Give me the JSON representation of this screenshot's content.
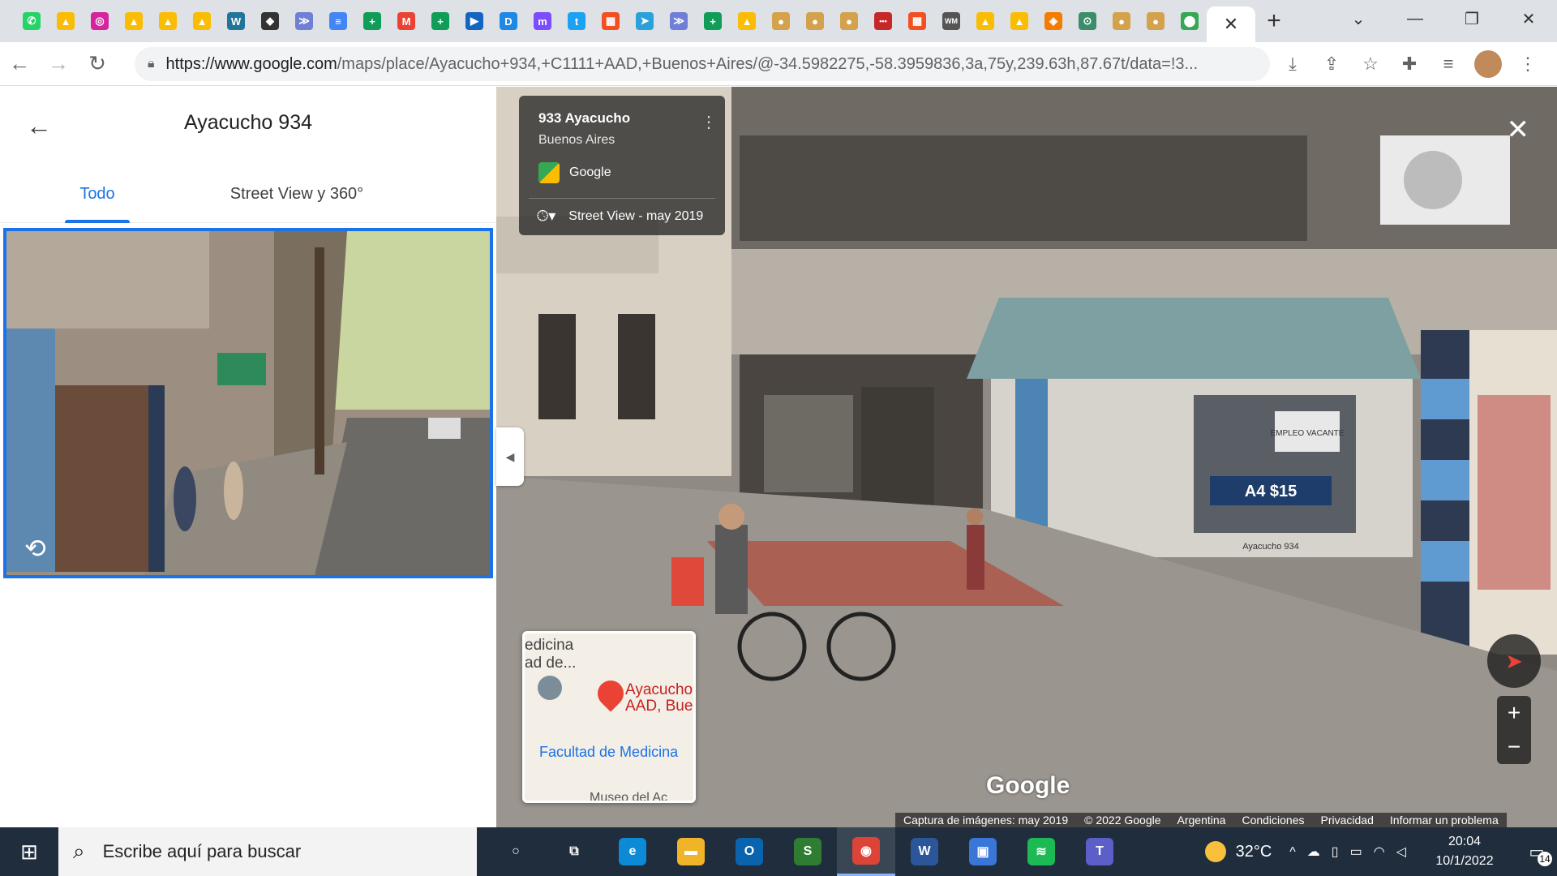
{
  "browser": {
    "favicons": [
      {
        "icon": "whatsapp-icon",
        "color": "#25d366",
        "glyph": "✆"
      },
      {
        "icon": "drive-icon",
        "color": "#fbbc04",
        "glyph": "▲"
      },
      {
        "icon": "instagram-icon",
        "color": "#d6249f",
        "glyph": "◎"
      },
      {
        "icon": "drive-icon",
        "color": "#fbbc04",
        "glyph": "▲"
      },
      {
        "icon": "drive-icon",
        "color": "#fbbc04",
        "glyph": "▲"
      },
      {
        "icon": "drive-icon",
        "color": "#fbbc04",
        "glyph": "▲"
      },
      {
        "icon": "wordpress-icon",
        "color": "#21759b",
        "glyph": "W"
      },
      {
        "icon": "shield-icon",
        "color": "#333333",
        "glyph": "◆"
      },
      {
        "icon": "stream-icon",
        "color": "#6f7fd6",
        "glyph": "≫"
      },
      {
        "icon": "docs-icon",
        "color": "#4285f4",
        "glyph": "≡"
      },
      {
        "icon": "sheets-icon",
        "color": "#0f9d58",
        "glyph": "+"
      },
      {
        "icon": "gmail-icon",
        "color": "#ea4335",
        "glyph": "M"
      },
      {
        "icon": "sheets-icon",
        "color": "#0f9d58",
        "glyph": "+"
      },
      {
        "icon": "play-icon",
        "color": "#1565c0",
        "glyph": "▶"
      },
      {
        "icon": "d-icon",
        "color": "#1e88e5",
        "glyph": "D"
      },
      {
        "icon": "m-icon",
        "color": "#7c4dff",
        "glyph": "m"
      },
      {
        "icon": "twitter-icon",
        "color": "#1da1f2",
        "glyph": "t"
      },
      {
        "icon": "windows-icon",
        "color": "#f25022",
        "glyph": "▦"
      },
      {
        "icon": "telegram-icon",
        "color": "#2aa1da",
        "glyph": "➤"
      },
      {
        "icon": "stream-icon",
        "color": "#6f7fd6",
        "glyph": "≫"
      },
      {
        "icon": "sheets-icon",
        "color": "#0f9d58",
        "glyph": "+"
      },
      {
        "icon": "drive-icon",
        "color": "#fbbc04",
        "glyph": "▲"
      },
      {
        "icon": "pie-icon",
        "color": "#d4a24c",
        "glyph": "●"
      },
      {
        "icon": "pie-icon",
        "color": "#d4a24c",
        "glyph": "●"
      },
      {
        "icon": "pie-icon",
        "color": "#d4a24c",
        "glyph": "●"
      },
      {
        "icon": "dots-icon",
        "color": "#c62828",
        "glyph": "•••"
      },
      {
        "icon": "windows-icon",
        "color": "#f25022",
        "glyph": "▦"
      },
      {
        "icon": "wm-icon",
        "color": "#555555",
        "glyph": "WM"
      },
      {
        "icon": "drive-icon",
        "color": "#fbbc04",
        "glyph": "▲"
      },
      {
        "icon": "drive-icon",
        "color": "#fbbc04",
        "glyph": "▲"
      },
      {
        "icon": "orange-icon",
        "color": "#f57c00",
        "glyph": "◈"
      },
      {
        "icon": "pin-icon",
        "color": "#3c8d6a",
        "glyph": "⊙"
      },
      {
        "icon": "pie-icon",
        "color": "#d4a24c",
        "glyph": "●"
      },
      {
        "icon": "pie-icon",
        "color": "#d4a24c",
        "glyph": "●"
      },
      {
        "icon": "maps-icon",
        "color": "#34a853",
        "glyph": "⬤"
      }
    ],
    "active_tab_close": "✕",
    "new_tab": "+",
    "url_host": "https://www.google.com",
    "url_path": "/maps/place/Ayacucho+934,+C1111+AAD,+Buenos+Aires/@-34.5982275,-58.3959836,3a,75y,239.63h,87.67t/data=!3..."
  },
  "left_panel": {
    "title": "Ayacucho 934",
    "tabs": [
      "Todo",
      "Street View y 360°"
    ]
  },
  "street_view": {
    "card_title": "933 Ayacucho",
    "card_subtitle": "Buenos Aires",
    "card_source": "Google",
    "card_history": "Street View - may 2019",
    "watermark": "Google",
    "minimap": {
      "label_top": "edicina\nad de...",
      "pin_label": "Ayacucho\nAAD, Bue",
      "facultad": "Facultad de Medicina",
      "museo": "Museo del Ac"
    },
    "attribution": [
      "Captura de imágenes: may 2019",
      "© 2022 Google",
      "Argentina",
      "Condiciones",
      "Privacidad",
      "Informar un problema"
    ],
    "scene_signs": [
      "A4 $15",
      "EMPLEO VACANTE",
      "Ayacucho 934"
    ]
  },
  "taskbar": {
    "search_placeholder": "Escribe aquí para buscar",
    "temperature": "32°C",
    "time": "20:04",
    "date": "10/1/2022",
    "notifications": "14",
    "apps": [
      {
        "icon": "cortana-icon",
        "color": "#1f2d3d",
        "glyph": "○"
      },
      {
        "icon": "taskview-icon",
        "color": "#1f2d3d",
        "glyph": "⧉"
      },
      {
        "icon": "edge-icon",
        "color": "#0c8ad6",
        "glyph": "e"
      },
      {
        "icon": "explorer-icon",
        "color": "#f0b429",
        "glyph": "▬"
      },
      {
        "icon": "outlook-icon",
        "color": "#0a64ad",
        "glyph": "O"
      },
      {
        "icon": "app-s-icon",
        "color": "#2e7d32",
        "glyph": "S"
      },
      {
        "icon": "chrome-icon",
        "color": "#db4437",
        "glyph": "◉"
      },
      {
        "icon": "word-icon",
        "color": "#2b579a",
        "glyph": "W"
      },
      {
        "icon": "phone-link-icon",
        "color": "#3a76d8",
        "glyph": "▣"
      },
      {
        "icon": "spotify-icon",
        "color": "#1db954",
        "glyph": "≋"
      },
      {
        "icon": "teams-icon",
        "color": "#5b5fc7",
        "glyph": "T"
      }
    ]
  }
}
